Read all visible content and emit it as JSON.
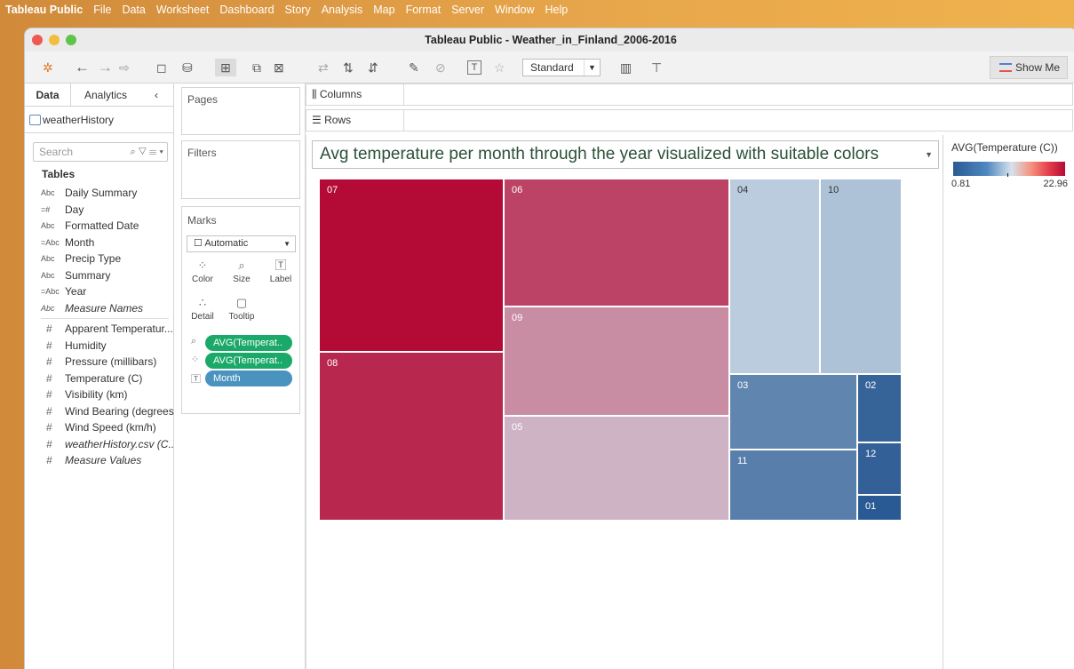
{
  "menubar": {
    "app": "Tableau Public",
    "items": [
      "File",
      "Data",
      "Worksheet",
      "Dashboard",
      "Story",
      "Analysis",
      "Map",
      "Format",
      "Server",
      "Window",
      "Help"
    ]
  },
  "window": {
    "title": "Tableau Public - Weather_in_Finland_2006-2016"
  },
  "toolbar": {
    "fit_select": "Standard",
    "show_me_label": "Show Me"
  },
  "data_pane": {
    "tabs": [
      "Data",
      "Analytics"
    ],
    "data_source": "weatherHistory",
    "search_placeholder": "Search",
    "tables_heading": "Tables",
    "dimensions": [
      {
        "type": "Abc",
        "name": "Daily Summary"
      },
      {
        "type": "=#",
        "name": "Day"
      },
      {
        "type": "Abc",
        "name": "Formatted Date"
      },
      {
        "type": "=Abc",
        "name": "Month"
      },
      {
        "type": "Abc",
        "name": "Precip Type"
      },
      {
        "type": "Abc",
        "name": "Summary"
      },
      {
        "type": "=Abc",
        "name": "Year"
      },
      {
        "type": "Abc",
        "name": "Measure Names",
        "italic": true
      }
    ],
    "measures": [
      {
        "type": "#",
        "name": "Apparent Temperatur..."
      },
      {
        "type": "#",
        "name": "Humidity"
      },
      {
        "type": "#",
        "name": "Pressure (millibars)"
      },
      {
        "type": "#",
        "name": "Temperature (C)"
      },
      {
        "type": "#",
        "name": "Visibility (km)"
      },
      {
        "type": "#",
        "name": "Wind Bearing (degrees)"
      },
      {
        "type": "#",
        "name": "Wind Speed (km/h)"
      },
      {
        "type": "#",
        "name": "weatherHistory.csv (C...",
        "italic": true
      },
      {
        "type": "#",
        "name": "Measure Values",
        "italic": true
      }
    ]
  },
  "shelves": {
    "pages": "Pages",
    "filters": "Filters",
    "marks": "Marks",
    "mark_type": "Automatic",
    "mark_buttons": [
      "Color",
      "Size",
      "Label",
      "Detail",
      "Tooltip"
    ],
    "mark_pills": [
      "AVG(Temperat..",
      "AVG(Temperat..",
      "Month"
    ],
    "columns": "Columns",
    "rows": "Rows"
  },
  "viz": {
    "title": "Avg temperature per month through the year visualized with suitable colors"
  },
  "legend": {
    "title": "AVG(Temperature (C))",
    "min": "0.81",
    "max": "22.96"
  },
  "chart_data": {
    "type": "treemap",
    "title": "Avg temperature per month through the year visualized with suitable colors",
    "size_measure": "AVG(Temperature (C))",
    "color_measure": "AVG(Temperature (C))",
    "color_range": [
      0.81,
      22.96
    ],
    "colors": {
      "low": "#2a5a93",
      "mid": "#d6e2ec",
      "high": "#b30b36"
    },
    "categories": [
      "07",
      "08",
      "06",
      "09",
      "05",
      "04",
      "10",
      "03",
      "11",
      "02",
      "12",
      "01"
    ],
    "values": [
      22.96,
      21.5,
      20.1,
      16.3,
      14.3,
      10.1,
      9.3,
      4.3,
      3.8,
      1.6,
      1.3,
      0.81
    ]
  }
}
